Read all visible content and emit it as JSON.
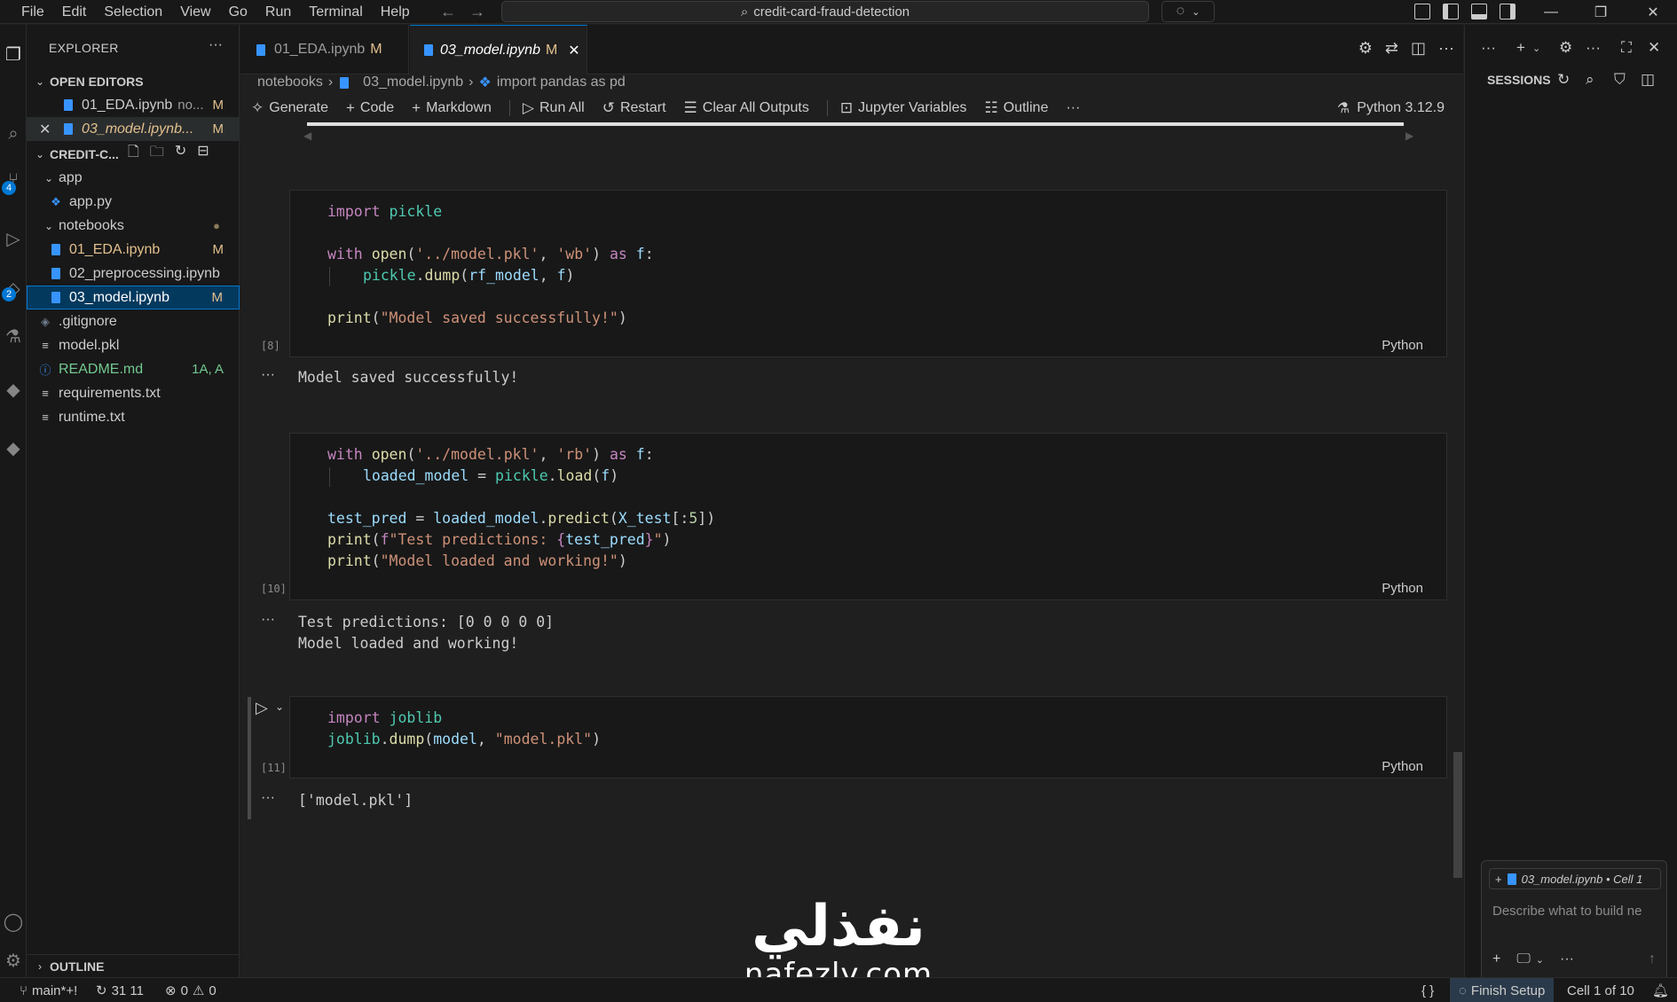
{
  "menu": [
    "File",
    "Edit",
    "Selection",
    "View",
    "Go",
    "Run",
    "Terminal",
    "Help"
  ],
  "search": {
    "text": "credit-card-fraud-detection"
  },
  "explorer": {
    "title": "EXPLORER",
    "open_editors_title": "OPEN EDITORS",
    "open_editors": [
      {
        "name": "01_EDA.ipynb",
        "suffix": "no...",
        "status": "M"
      },
      {
        "name": "03_model.ipynb...",
        "status": "M"
      }
    ],
    "project_title": "CREDIT-C...",
    "tree": [
      {
        "label": "app",
        "type": "folder"
      },
      {
        "label": "app.py",
        "type": "python"
      },
      {
        "label": "notebooks",
        "type": "folder",
        "status": "●"
      },
      {
        "label": "01_EDA.ipynb",
        "type": "notebook",
        "status": "M"
      },
      {
        "label": "02_preprocessing.ipynb",
        "type": "notebook"
      },
      {
        "label": "03_model.ipynb",
        "type": "notebook",
        "status": "M"
      },
      {
        "label": ".gitignore",
        "type": "git"
      },
      {
        "label": "model.pkl",
        "type": "file"
      },
      {
        "label": "README.md",
        "type": "info",
        "status": "1A, A"
      },
      {
        "label": "requirements.txt",
        "type": "file"
      },
      {
        "label": "runtime.txt",
        "type": "file"
      }
    ],
    "outline_title": "OUTLINE"
  },
  "tabs": [
    {
      "label": "01_EDA.ipynb",
      "status": "M"
    },
    {
      "label": "03_model.ipynb",
      "status": "M"
    }
  ],
  "breadcrumb": {
    "folder": "notebooks",
    "file": "03_model.ipynb",
    "cell": "import pandas as pd"
  },
  "toolbar": {
    "generate": "Generate",
    "code": "Code",
    "markdown": "Markdown",
    "run_all": "Run All",
    "restart": "Restart",
    "clear_outputs": "Clear All Outputs",
    "variables": "Jupyter Variables",
    "outline": "Outline",
    "kernel": "Python 3.12.9"
  },
  "cells": [
    {
      "count": "[8]",
      "language": "Python",
      "output": [
        "Model saved successfully!"
      ]
    },
    {
      "count": "[10]",
      "language": "Python",
      "output": [
        "Test predictions: [0 0 0 0 0]",
        "Model loaded and working!"
      ]
    },
    {
      "count": "[11]",
      "language": "Python",
      "output": [
        "['model.pkl']"
      ]
    }
  ],
  "right_panel": {
    "sessions_title": "SESSIONS",
    "chat_context": "03_model.ipynb • Cell 1",
    "chat_placeholder": "Describe what to build ne"
  },
  "statusbar": {
    "branch": "main*+!",
    "sync": "31 11",
    "errors": "0",
    "warnings": "0",
    "braces": "{ }",
    "finish_setup": "Finish Setup",
    "cell_pos": "Cell 1 of 10"
  },
  "watermark": {
    "arabic": "نفذلي",
    "latin": "nafezly.com"
  },
  "colors": {
    "accent": "#0078d4",
    "modified": "#e2c08d",
    "background": "#1f1f1f"
  }
}
